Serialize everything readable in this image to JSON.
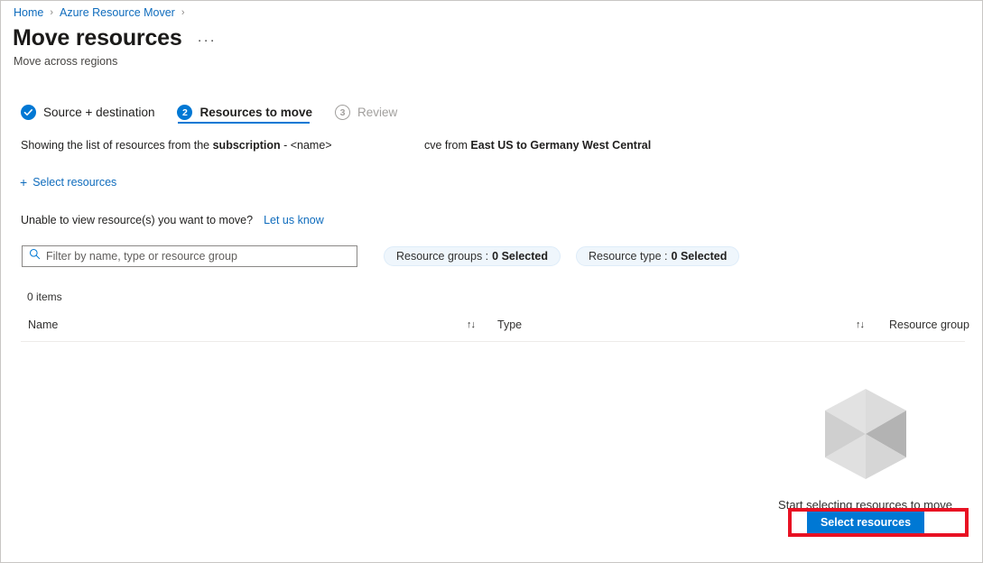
{
  "breadcrumb": {
    "items": [
      {
        "label": "Home"
      },
      {
        "label": "Azure Resource Mover"
      }
    ],
    "separator": "›"
  },
  "header": {
    "title": "Move resources",
    "subtitle": "Move across regions",
    "more_menu": "···"
  },
  "wizard": {
    "steps": [
      {
        "badge": "✓",
        "label": "Source + destination",
        "state": "completed"
      },
      {
        "badge": "2",
        "label": "Resources to move",
        "state": "active"
      },
      {
        "badge": "3",
        "label": "Review",
        "state": "disabled"
      }
    ]
  },
  "description": {
    "left_prefix": "Showing the list of resources from the ",
    "left_bold": "subscription",
    "left_suffix": " - <name>",
    "right_prefix": "ᴄve from ",
    "right_bold": "East US to Germany West Central"
  },
  "commands": {
    "select_resources": {
      "plus": "+",
      "label": "Select resources"
    }
  },
  "help": {
    "question": "Unable to view resource(s) you want to move?",
    "link": "Let us know"
  },
  "filters": {
    "search": {
      "placeholder": "Filter by name, type or resource group",
      "value": "",
      "icon": "search-icon"
    },
    "pills": [
      {
        "label": "Resource groups :",
        "value": "0 Selected"
      },
      {
        "label": "Resource type :",
        "value": "0 Selected"
      }
    ]
  },
  "table": {
    "items_count": "0 items",
    "columns": [
      {
        "label": "Name",
        "sortable": true
      },
      {
        "label": "Type",
        "sortable": true
      },
      {
        "label": "Resource group",
        "sortable": false
      }
    ],
    "sort_glyph": "↑↓",
    "rows": []
  },
  "empty_state": {
    "illustration": "cube-icon",
    "message": "Start selecting resources to move",
    "button_label": "Select resources",
    "highlight_color": "#e81123"
  },
  "colors": {
    "accent": "#0078d4",
    "link": "#0f6cbd",
    "highlight": "#e81123",
    "pill_bg": "#eff6fc",
    "border": "#c8c6c4"
  }
}
